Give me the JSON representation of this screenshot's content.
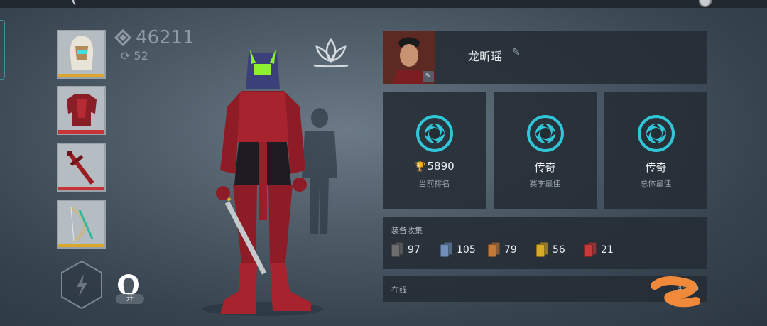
{
  "equipment_slots": [
    {
      "name": "helmet",
      "rarity_color": "#d9a72c"
    },
    {
      "name": "armor",
      "rarity_color": "#c8333a"
    },
    {
      "name": "sword",
      "rarity_color": "#c8333a"
    },
    {
      "name": "bow",
      "rarity_color": "#d9a72c"
    }
  ],
  "currency": {
    "value": "46211",
    "icon": "diamond-icon"
  },
  "refresh": {
    "value": "52",
    "icon": "refresh-icon"
  },
  "toggle": {
    "label": "开"
  },
  "profile": {
    "name": "龙昕瑶"
  },
  "stats": [
    {
      "value": "5890",
      "label": "当前排名",
      "has_trophy": true
    },
    {
      "value": "传奇",
      "label": "赛季最佳"
    },
    {
      "value": "传奇",
      "label": "总体最佳"
    }
  ],
  "collection": {
    "title": "装备收集",
    "items": [
      {
        "count": "97",
        "color": "#6e6e6e"
      },
      {
        "count": "105",
        "color": "#6f8fb8"
      },
      {
        "count": "79",
        "color": "#c67a3a"
      },
      {
        "count": "56",
        "color": "#d8ac2a"
      },
      {
        "count": "21",
        "color": "#c83a3a"
      }
    ]
  },
  "status": {
    "label": "在线",
    "value": "4:?09"
  },
  "colors": {
    "accent_teal": "#30c6d8",
    "panel": "#242c34"
  }
}
